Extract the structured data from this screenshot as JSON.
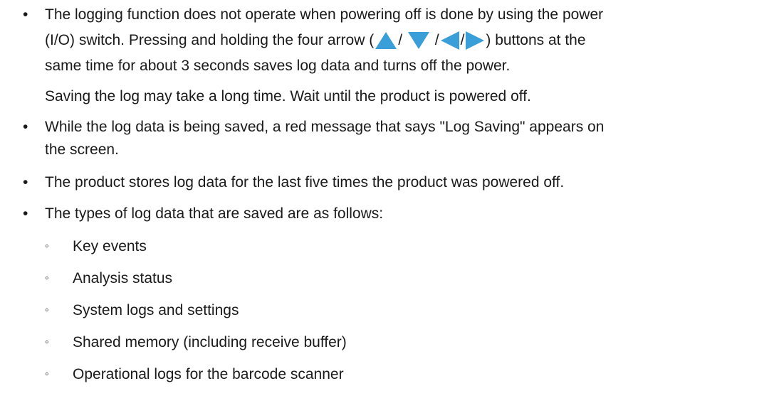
{
  "bullets": [
    {
      "marker": "•",
      "line1_before": "The logging function does not operate when powering off is done by using the power",
      "line2_before": "(I/O) switch. Pressing and holding the four arrow (",
      "sep1": "/",
      "sep2": "/",
      "sep3": "/",
      "line2_after": ") buttons at the",
      "line3": "same time for about 3 seconds saves log data and turns off the power.",
      "note": "Saving the log may take a long time. Wait until the product is powered off."
    },
    {
      "marker": "•",
      "line1": "While the log data is being saved, a red message that says \"Log Saving\" appears on",
      "line2": "the screen."
    },
    {
      "marker": "•",
      "line1": "The product stores log data for the last five times the product was powered off."
    },
    {
      "marker": "•",
      "line1": "The types of log data that are saved are as follows:"
    }
  ],
  "log_types": [
    {
      "marker": "◦",
      "label": "Key events"
    },
    {
      "marker": "◦",
      "label": "Analysis status"
    },
    {
      "marker": "◦",
      "label": "System logs and settings"
    },
    {
      "marker": "◦",
      "label": "Shared memory (including receive buffer)"
    },
    {
      "marker": "◦",
      "label": "Operational logs for the barcode scanner"
    }
  ],
  "arrows": [
    {
      "icon": "arrow-up-icon",
      "color": "#3a9fd8"
    },
    {
      "icon": "arrow-down-icon",
      "color": "#3a9fd8"
    },
    {
      "icon": "arrow-left-icon",
      "color": "#3a9fd8"
    },
    {
      "icon": "arrow-right-icon",
      "color": "#3a9fd8"
    }
  ]
}
